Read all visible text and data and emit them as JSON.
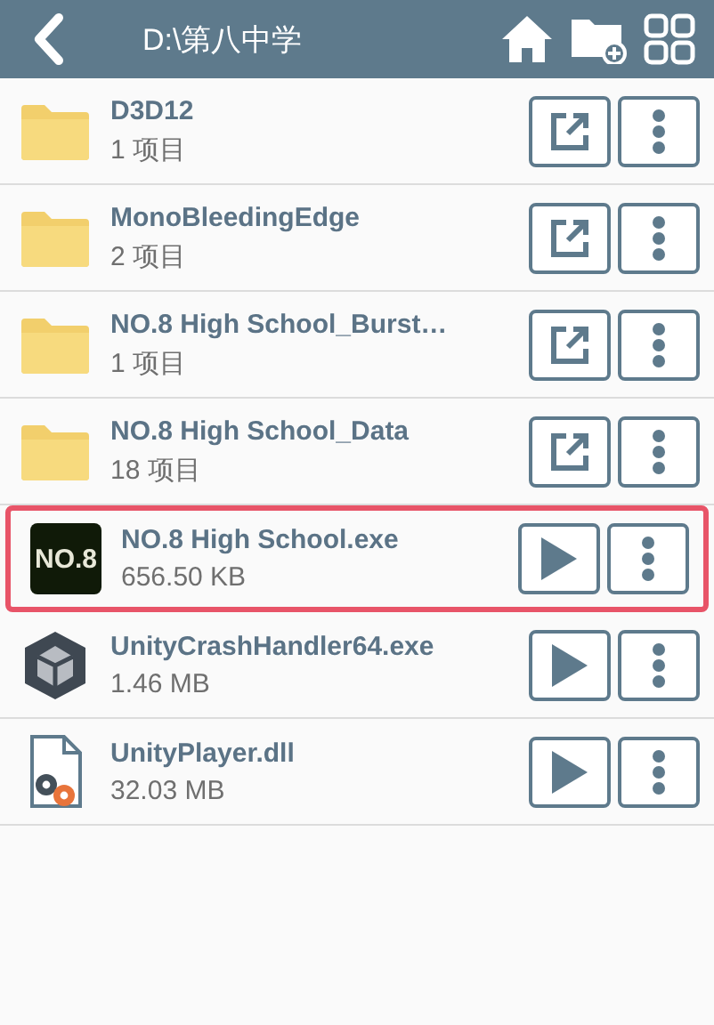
{
  "header": {
    "path": "D:\\第八中学"
  },
  "files": [
    {
      "name": "D3D12",
      "info": "1 项目",
      "kind": "folder",
      "action": {
        "kind": "open"
      },
      "selected": false
    },
    {
      "name": "MonoBleedingEdge",
      "info": "2 项目",
      "kind": "folder",
      "action": {
        "kind": "open"
      },
      "selected": false
    },
    {
      "name": "NO.8 High School_Burst…",
      "info": "1 项目",
      "kind": "folder",
      "action": {
        "kind": "open"
      },
      "selected": false
    },
    {
      "name": "NO.8 High School_Data",
      "info": "18 项目",
      "kind": "folder",
      "action": {
        "kind": "open"
      },
      "selected": false
    },
    {
      "name": "NO.8 High School.exe",
      "info": "656.50 KB",
      "kind": "app",
      "icon_text": "NO.8",
      "action": {
        "kind": "run"
      },
      "selected": true
    },
    {
      "name": "UnityCrashHandler64.exe",
      "info": "1.46 MB",
      "kind": "unity",
      "action": {
        "kind": "run"
      },
      "selected": false
    },
    {
      "name": "UnityPlayer.dll",
      "info": "32.03 MB",
      "kind": "dll",
      "action": {
        "kind": "run"
      },
      "selected": false
    }
  ]
}
